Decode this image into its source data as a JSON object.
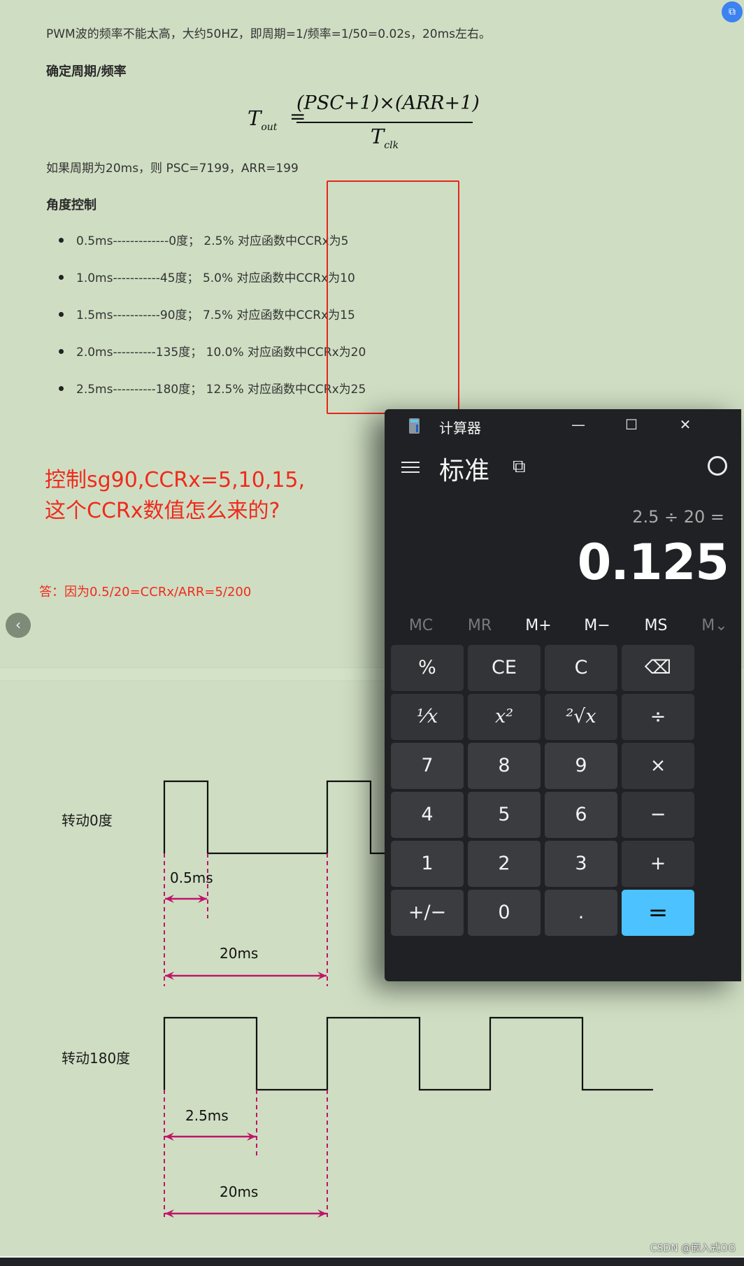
{
  "article": {
    "intro": "PWM波的频率不能太高，大约50HZ，即周期=1/频率=1/50=0.02s，20ms左右。",
    "section1_heading": "确定周期/频率",
    "formula": {
      "lhs": "T",
      "lhs_sub": "out",
      "equals": "=",
      "numerator": "(PSC+1)×(ARR+1)",
      "denominator": "T",
      "denominator_sub": "clk"
    },
    "period_note": "如果周期为20ms，则 PSC=7199，ARR=199",
    "section2_heading": "角度控制",
    "angle_list": [
      "0.5ms-------------0度；  2.5% 对应函数中CCRx为5",
      "1.0ms-----------45度；  5.0% 对应函数中CCRx为10",
      "1.5ms-----------90度；  7.5% 对应函数中CCRx为15",
      "2.0ms----------135度；  10.0% 对应函数中CCRx为20",
      "2.5ms----------180度；  12.5% 对应函数中CCRx为25"
    ],
    "question_line1": "控制sg90,CCRx=5,10,15,",
    "question_line2": "这个CCRx数值怎么来的?",
    "answer": "答：因为0.5/20=CCRx/ARR=5/200",
    "nav_back_icon": "‹",
    "top_badge_icon": "⧉"
  },
  "diagram": {
    "wave0_label": "转动0度",
    "wave0_pulse_label": "0.5ms",
    "wave0_period_label": "20ms",
    "wave0_pulse_ms": 0.5,
    "wave180_label": "转动180度",
    "wave180_pulse_label": "2.5ms",
    "wave180_period_label": "20ms",
    "wave180_pulse_ms": 2.5,
    "period_ms": 20,
    "annotation_color": "#c0146a",
    "signal_color": "#111111"
  },
  "calculator": {
    "title": "计算器",
    "minimize": "—",
    "maximize": "☐",
    "close": "✕",
    "mode": "标准",
    "keep_on_top_icon": "⧉",
    "history_icon": "↺",
    "expression": "2.5 ÷ 20 =",
    "result": "0.125",
    "memory": [
      {
        "label": "MC",
        "enabled": false
      },
      {
        "label": "MR",
        "enabled": false
      },
      {
        "label": "M+",
        "enabled": true
      },
      {
        "label": "M−",
        "enabled": true
      },
      {
        "label": "MS",
        "enabled": true
      },
      {
        "label": "M⌄",
        "enabled": false
      }
    ],
    "keys": [
      [
        "%",
        "CE",
        "C",
        "⌫"
      ],
      [
        "¹⁄x",
        "x²",
        "²√x",
        "÷"
      ],
      [
        "7",
        "8",
        "9",
        "×"
      ],
      [
        "4",
        "5",
        "6",
        "−"
      ],
      [
        "1",
        "2",
        "3",
        "+"
      ],
      [
        "+/−",
        "0",
        ".",
        "="
      ]
    ],
    "accent_color": "#4cc2ff"
  },
  "watermark": "CSDN @嵌入式OG"
}
